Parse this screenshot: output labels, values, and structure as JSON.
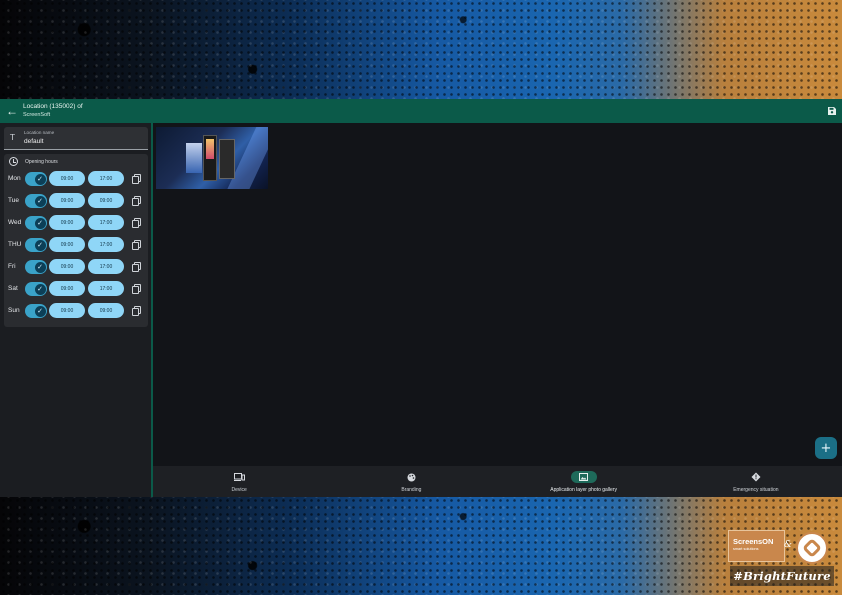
{
  "appbar": {
    "title": "Location (135002) of",
    "subtitle": "ScreenSoft"
  },
  "location_field": {
    "label": "Location name",
    "value": "default"
  },
  "opening_hours": {
    "title": "Opening hours",
    "days": [
      {
        "day": "Mon",
        "enabled": true,
        "from": "09:00",
        "to": "17:00"
      },
      {
        "day": "Tue",
        "enabled": true,
        "from": "09:00",
        "to": "09:00"
      },
      {
        "day": "Wed",
        "enabled": true,
        "from": "09:00",
        "to": "17:00"
      },
      {
        "day": "THU",
        "enabled": true,
        "from": "09:00",
        "to": "17:00"
      },
      {
        "day": "Fri",
        "enabled": true,
        "from": "09:00",
        "to": "17:00"
      },
      {
        "day": "Sat",
        "enabled": true,
        "from": "09:00",
        "to": "17:00"
      },
      {
        "day": "Sun",
        "enabled": true,
        "from": "09:00",
        "to": "09:00"
      }
    ]
  },
  "fab": {
    "label": "+"
  },
  "bottom_nav": {
    "items": [
      {
        "label": "Device",
        "icon": "device-icon",
        "active": false
      },
      {
        "label": "Branding",
        "icon": "palette-icon",
        "active": false
      },
      {
        "label": "Application layer photo gallery",
        "icon": "image-icon",
        "active": true
      },
      {
        "label": "Emergency situation",
        "icon": "warning-diamond-icon",
        "active": false
      }
    ]
  },
  "branding": {
    "brand_name": "ScreensON",
    "brand_tagline": "smart solutions",
    "hashtag": "#BrightFuture"
  },
  "colors": {
    "appbar": "#0b5a49",
    "toggle": "#3aa3c9",
    "time_chip": "#8fd6f7",
    "fab": "#1b6f86",
    "active_nav": "#1e6a5a"
  }
}
